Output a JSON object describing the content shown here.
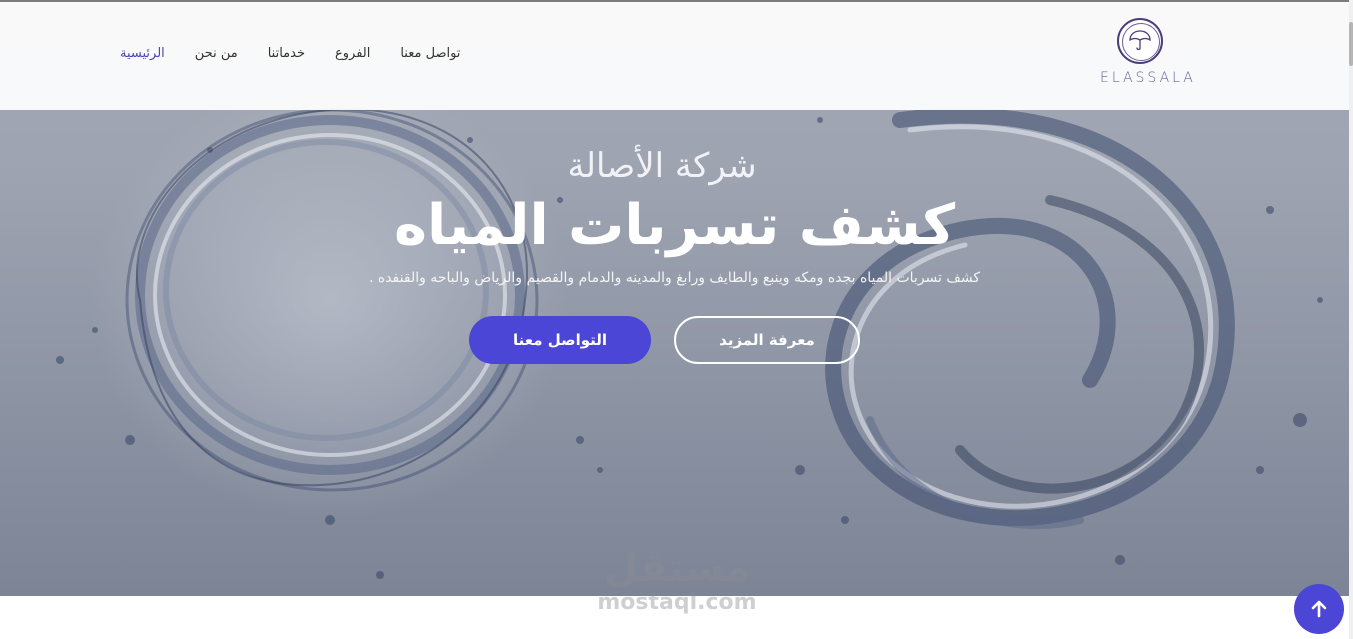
{
  "brand": {
    "logo_text": "ELASSALA",
    "logo_icon": "umbrella-icon"
  },
  "nav": {
    "items": [
      {
        "label": "الرئيسية",
        "active": true
      },
      {
        "label": "من نحن",
        "active": false
      },
      {
        "label": "خدماتنا",
        "active": false
      },
      {
        "label": "الفروع",
        "active": false
      },
      {
        "label": "تواصل معنا",
        "active": false
      }
    ]
  },
  "hero": {
    "company_name": "شركة الأصالة",
    "headline": "كشف تسربات المياه",
    "subtitle": "كشف تسربات المياه بجده ومكه وينبع والطايف ورابغ والمدينه والدمام والقصيم والرياض والباحه والقنفده .",
    "contact_button": "التواصل معنا",
    "more_button": "معرفة المزيد"
  },
  "watermark": {
    "arabic": "مستقل",
    "latin": "mostaql.com"
  },
  "scroll_top": {
    "icon": "arrow-up-icon"
  },
  "colors": {
    "accent": "#4c46d6",
    "active_nav": "#4c46b6",
    "logo": "#4a3d7a"
  }
}
